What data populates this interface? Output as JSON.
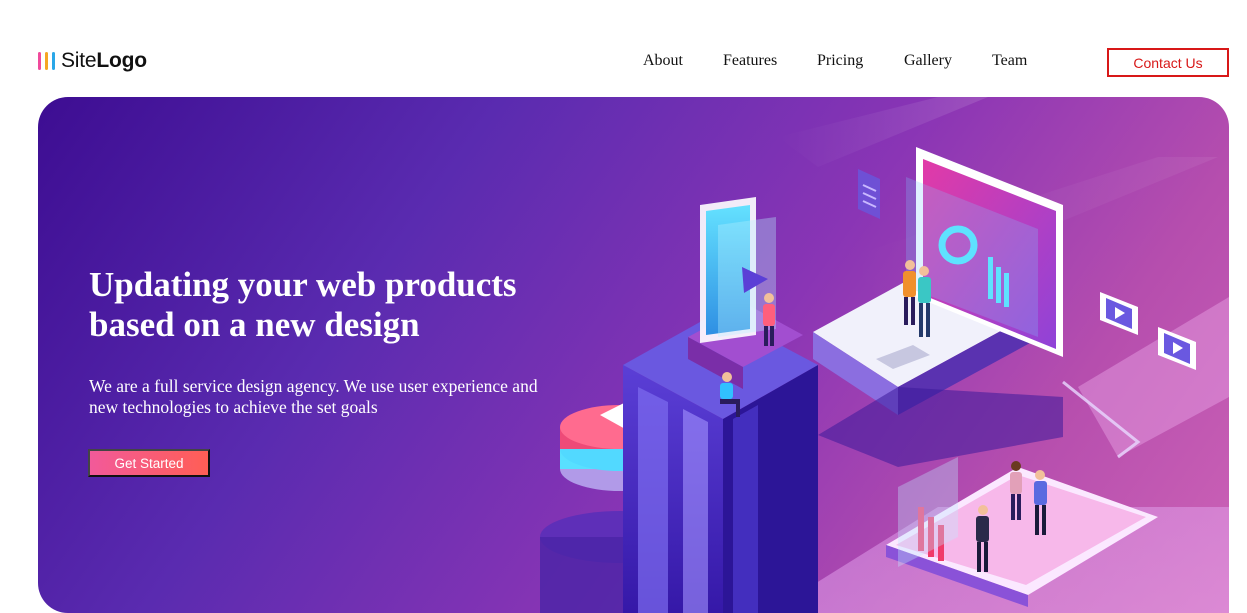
{
  "header": {
    "logo": {
      "text_light": "Site",
      "text_bold": "Logo",
      "mark_colors": [
        "#f04a9c",
        "#f5a623",
        "#2aa7e8"
      ]
    },
    "nav": [
      {
        "label": "About"
      },
      {
        "label": "Features"
      },
      {
        "label": "Pricing"
      },
      {
        "label": "Gallery"
      },
      {
        "label": "Team"
      }
    ],
    "contact_label": "Contact Us"
  },
  "hero": {
    "title": "Updating your web products based on a new design",
    "subtitle": "We are a full service design agency. We use user experience and new technologies to achieve the set goals",
    "cta_label": "Get Started",
    "illustration": "isometric-design-agency-illustration"
  },
  "colors": {
    "contact_accent": "#d81818",
    "hero_gradient_start": "#3d0d92",
    "hero_gradient_end": "#cd63b6",
    "cta_gradient_start": "#f25a9a",
    "cta_gradient_end": "#ff5e55"
  }
}
